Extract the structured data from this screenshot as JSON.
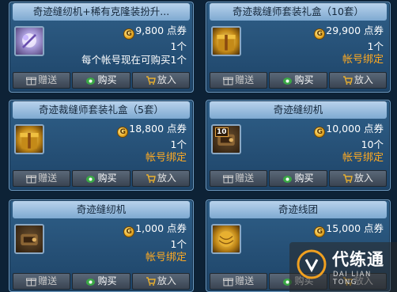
{
  "cards": [
    {
      "title": "奇迹缝纫机+稀有克隆装扮升...",
      "icon": "purple-sewing-machine-icon",
      "icon_style": "purple",
      "level": "",
      "price": "9,800 点券",
      "quantity": "1个",
      "extra": "每个帐号现在可购买1个",
      "extra_type": "notice"
    },
    {
      "title": "奇迹裁缝师套装礼盒（10套）",
      "icon": "gold-gift-box-icon",
      "icon_style": "gold",
      "level": "",
      "price": "29,900 点券",
      "quantity": "1个",
      "extra": "帐号绑定",
      "extra_type": "bind"
    },
    {
      "title": "奇迹裁缝师套装礼盒（5套）",
      "icon": "gold-gift-box-icon",
      "icon_style": "gold",
      "level": "",
      "price": "18,800 点券",
      "quantity": "1个",
      "extra": "帐号绑定",
      "extra_type": "bind"
    },
    {
      "title": "奇迹缝纫机",
      "icon": "sewing-machine-icon",
      "icon_style": "dark",
      "level": "10",
      "price": "10,000 点券",
      "quantity": "10个",
      "extra": "帐号绑定",
      "extra_type": "bind"
    },
    {
      "title": "奇迹缝纫机",
      "icon": "sewing-machine-icon",
      "icon_style": "dark",
      "level": "",
      "price": "1,000 点券",
      "quantity": "1个",
      "extra": "帐号绑定",
      "extra_type": "bind"
    },
    {
      "title": "奇迹线团",
      "icon": "thread-ball-icon",
      "icon_style": "gold",
      "level": "",
      "price": "15,000 点券",
      "quantity": "",
      "extra": "",
      "extra_type": "bind"
    }
  ],
  "buttons": {
    "gift": "赠送",
    "buy": "购买",
    "cart": "放入"
  },
  "coin_symbol": "G",
  "watermark": {
    "title": "代练通",
    "subtitle": "DAI LIAN TONG"
  },
  "colors": {
    "bind_text": "#ffaa22",
    "card_bg": "#2f5f88",
    "title_bg": "#9fc0e0"
  }
}
